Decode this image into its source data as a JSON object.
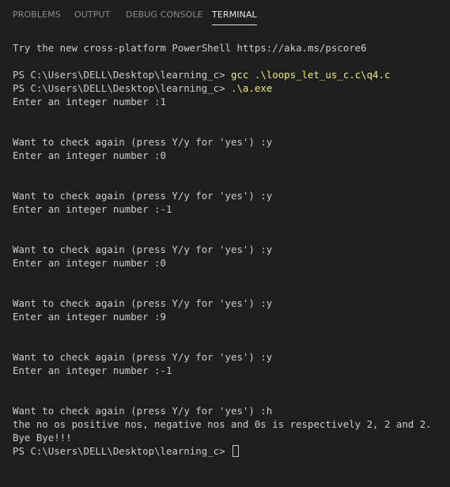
{
  "tabs": [
    {
      "label": "PROBLEMS",
      "active": false
    },
    {
      "label": "OUTPUT",
      "active": false
    },
    {
      "label": "DEBUG CONSOLE",
      "active": false
    },
    {
      "label": "TERMINAL",
      "active": true
    }
  ],
  "terminal": {
    "banner": "Try the new cross-platform PowerShell https://aka.ms/pscore6",
    "prompt": "PS C:\\Users\\DELL\\Desktop\\learning_c> ",
    "command1": "gcc .\\loops_let_us_c.c\\q4.c",
    "command2": ".\\a.exe",
    "entries": [
      {
        "enter": "Enter an integer number :1",
        "check": "Want to check again (press Y/y for 'yes') :y"
      },
      {
        "enter": "Enter an integer number :0",
        "check": "Want to check again (press Y/y for 'yes') :y"
      },
      {
        "enter": "Enter an integer number :-1",
        "check": "Want to check again (press Y/y for 'yes') :y"
      },
      {
        "enter": "Enter an integer number :0",
        "check": "Want to check again (press Y/y for 'yes') :y"
      },
      {
        "enter": "Enter an integer number :9",
        "check": "Want to check again (press Y/y for 'yes') :y"
      },
      {
        "enter": "Enter an integer number :-1",
        "check": "Want to check again (press Y/y for 'yes') :h"
      }
    ],
    "summary": "the no os positive nos, negative nos and 0s is respectively 2, 2 and 2.",
    "farewell": "Bye Bye!!!",
    "final_prompt": "PS C:\\Users\\DELL\\Desktop\\learning_c> "
  },
  "colors": {
    "background": "#1e1e1e",
    "text": "#cccccc",
    "command": "#ecec7a",
    "tab_inactive": "#8b8b8b",
    "tab_active": "#e7e7e7"
  }
}
